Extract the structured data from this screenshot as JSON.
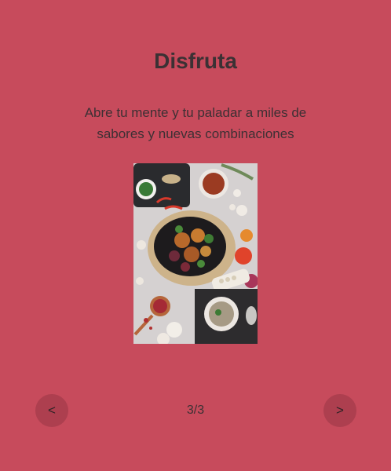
{
  "slide": {
    "title": "Disfruta",
    "text": "Abre tu mente y tu paladar a miles de\nsabores  y nuevas combinaciones",
    "counter": "3/3"
  },
  "controls": {
    "prev_label": "<",
    "next_label": ">"
  },
  "colors": {
    "background": "#c74b5c",
    "button": "#ad3f4f"
  }
}
